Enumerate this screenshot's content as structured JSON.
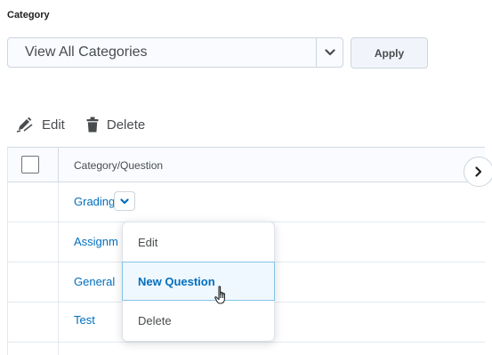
{
  "filter": {
    "label": "Category",
    "select_value": "View All Categories",
    "apply_label": "Apply"
  },
  "toolbar": {
    "edit_label": "Edit",
    "delete_label": "Delete"
  },
  "table": {
    "header": "Category/Question",
    "rows": [
      {
        "label": "Grading"
      },
      {
        "label": "Assignm"
      },
      {
        "label": "General"
      },
      {
        "label": "Test"
      }
    ]
  },
  "context_menu": {
    "items": [
      {
        "label": "Edit"
      },
      {
        "label": "New Question",
        "highlighted": true
      },
      {
        "label": "Delete"
      }
    ]
  },
  "colors": {
    "link": "#006fbf",
    "text": "#494c4e",
    "menu_highlight_border": "#83c4e9",
    "menu_highlight_bg": "#f0f8ff"
  }
}
